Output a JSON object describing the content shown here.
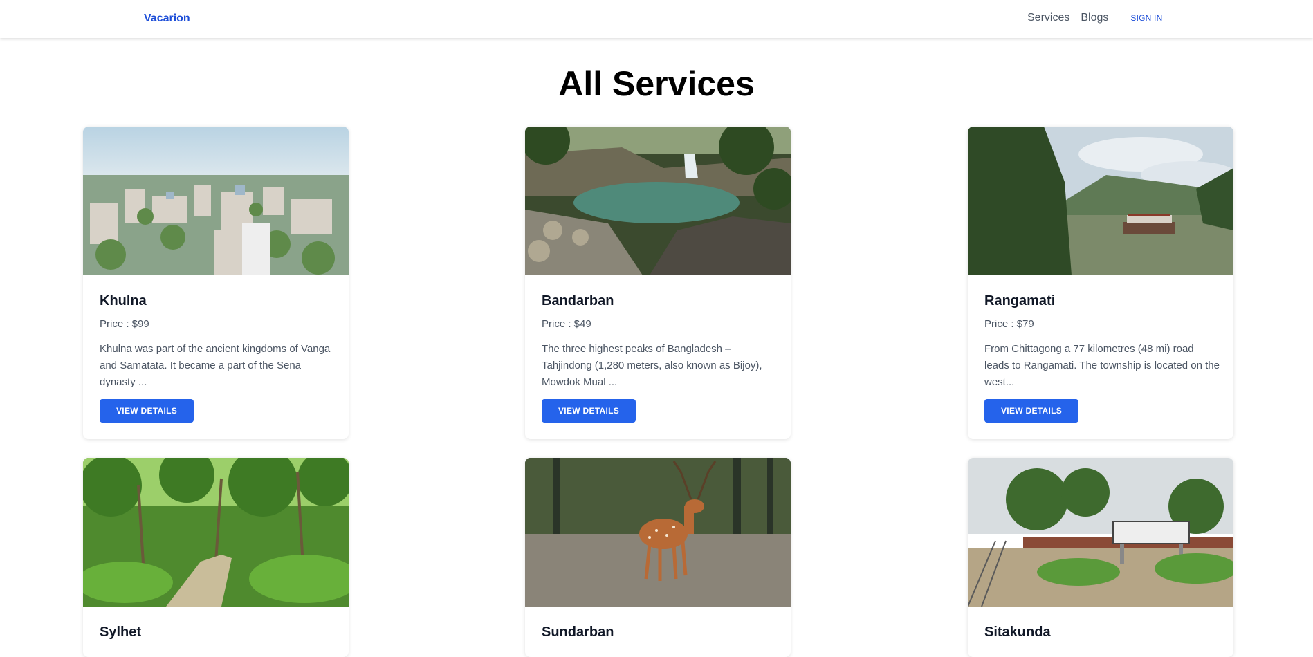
{
  "nav": {
    "brand": "Vacarion",
    "links": [
      "Services",
      "Blogs"
    ],
    "sign_in": "SIGN IN"
  },
  "page": {
    "title": "All Services"
  },
  "cards": [
    {
      "title": "Khulna",
      "price": "Price : $99",
      "description": "Khulna was part of the ancient kingdoms of Vanga and Samatata. It became a part of the Sena dynasty ...",
      "button": "VIEW DETAILS",
      "image": "city-skyline-image"
    },
    {
      "title": "Bandarban",
      "price": "Price : $49",
      "description": "The three highest peaks of Bangladesh – Tahjindong (1,280 meters, also known as Bijoy), Mowdok Mual ...",
      "button": "VIEW DETAILS",
      "image": "waterfall-image"
    },
    {
      "title": "Rangamati",
      "price": "Price : $79",
      "description": "From Chittagong a 77 kilometres (48 mi) road leads to Rangamati. The township is located on the west...",
      "button": "VIEW DETAILS",
      "image": "lake-boat-image"
    },
    {
      "title": "Sylhet",
      "image": "tea-garden-path-image"
    },
    {
      "title": "Sundarban",
      "image": "spotted-deer-image"
    },
    {
      "title": "Sitakunda",
      "image": "railway-station-image"
    }
  ]
}
